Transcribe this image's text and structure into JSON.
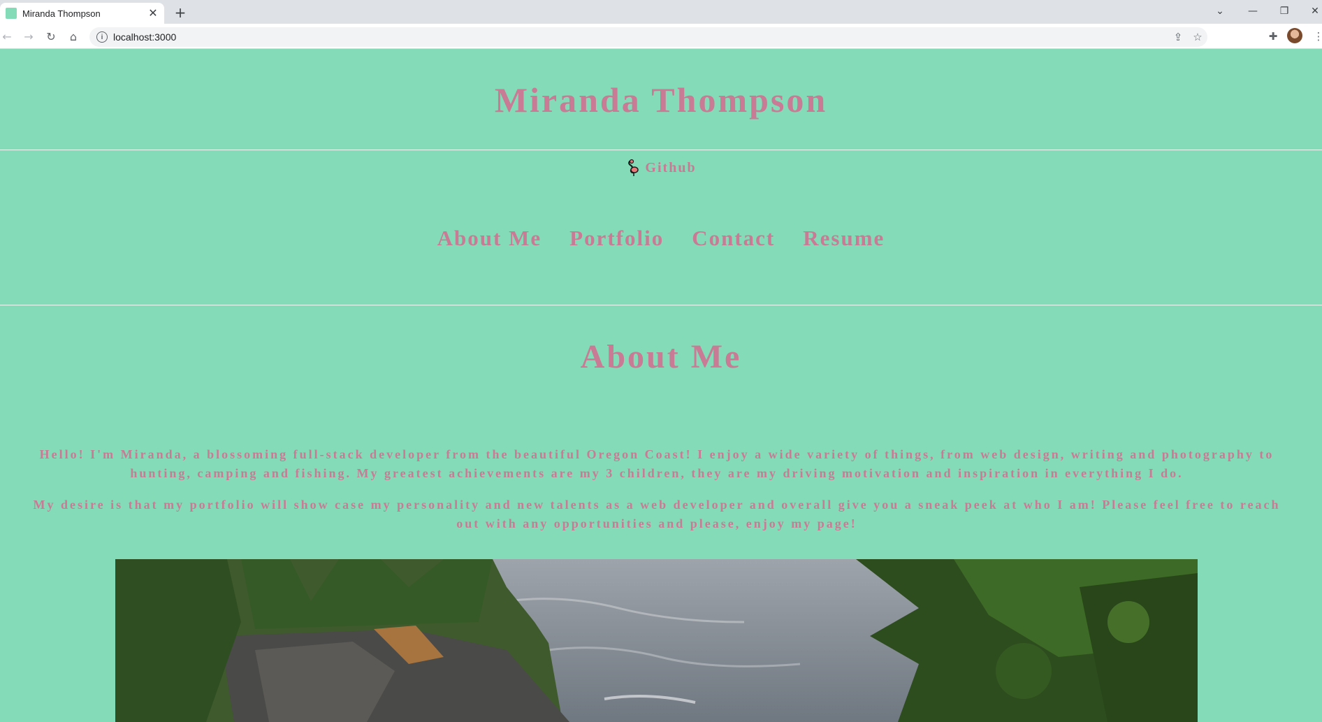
{
  "browser": {
    "tab_title": "Miranda Thompson",
    "tab_close_icon": "close-icon",
    "new_tab_icon": "plus-icon",
    "url": "localhost:3000",
    "window_controls": [
      "chevron-down-icon",
      "minimize-icon",
      "restore-icon",
      "close-icon"
    ],
    "toolbar_icons": [
      "back-icon",
      "forward-icon",
      "reload-icon",
      "home-icon",
      "share-icon",
      "star-icon",
      "puzzle-icon",
      "profile-avatar",
      "more-icon"
    ]
  },
  "header": {
    "title": "Miranda Thompson",
    "github_label": "Github",
    "github_icon": "flamingo-icon"
  },
  "nav": {
    "items": [
      {
        "label": "About Me"
      },
      {
        "label": "Portfolio"
      },
      {
        "label": "Contact"
      },
      {
        "label": "Resume"
      }
    ]
  },
  "about": {
    "title": "About Me",
    "paragraphs": [
      "Hello! I'm Miranda, a blossoming full-stack developer from the beautiful Oregon Coast! I enjoy a wide variety of things, from web design, writing and photography to hunting, camping and fishing. My greatest achievements are my 3 children, they are my driving motivation and inspiration in everything I do.",
      "My desire is that my portfolio will show case my personality and new talents as a web developer and overall give you a sneak peek at who I am! Please feel free to reach out with any opportunities and please, enjoy my page!"
    ],
    "image": "oregon-coast-photo"
  },
  "colors": {
    "background": "#84dbb7",
    "text_accent": "#c97a95"
  }
}
